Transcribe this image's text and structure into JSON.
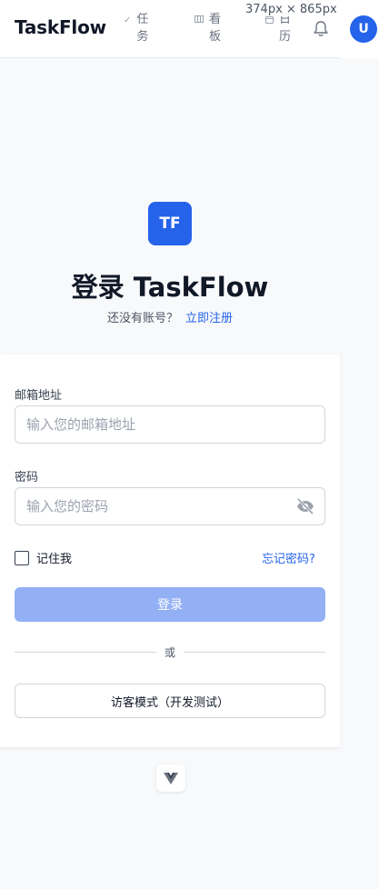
{
  "app": {
    "brand": "TaskFlow",
    "avatar_initial": "U"
  },
  "viewport_badge": "374px × 865px",
  "nav": {
    "tasks": {
      "label": "任务",
      "icon": "check-icon"
    },
    "board": {
      "label": "看板",
      "icon": "board-icon"
    },
    "calendar": {
      "label": "日历",
      "icon": "calendar-icon"
    }
  },
  "hero": {
    "logo_text": "TF",
    "title": "登录 TaskFlow",
    "no_account": "还没有账号？",
    "signup_link": "立即注册"
  },
  "form": {
    "email_label": "邮箱地址",
    "email_placeholder": "输入您的邮箱地址",
    "email_value": "",
    "password_label": "密码",
    "password_placeholder": "输入您的密码",
    "password_value": "",
    "remember_label": "记住我",
    "remember_checked": false,
    "forgot_link": "忘记密码?",
    "login_button": "登录",
    "divider_text": "或",
    "guest_button": "访客模式（开发测试）"
  },
  "colors": {
    "accent": "#2563eb",
    "button_disabled": "#93b0f5",
    "background": "#f8f9fb"
  }
}
